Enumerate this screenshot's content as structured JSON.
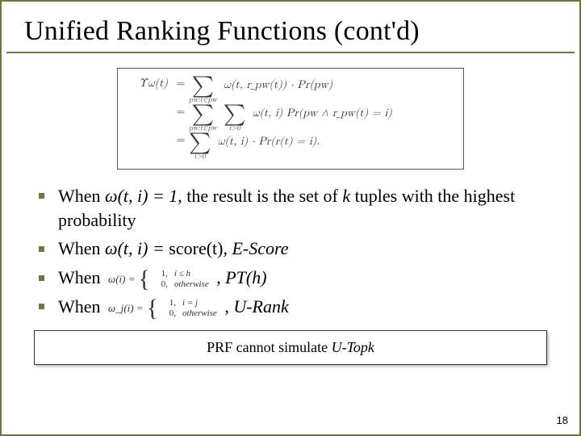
{
  "slide": {
    "title": "Unified Ranking Functions (cont'd)",
    "page_number": "18"
  },
  "equations": {
    "lhs": "Υω(t)",
    "eq": "=",
    "row1_sub": "pw:t∈pw",
    "row1_rhs": "ω(t, r_pw(t)) · Pr(pw)",
    "row2_sub1": "pw:t∈pw",
    "row2_sub2": "i>0",
    "row2_rhs": "ω(t, i) Pr(pw ∧ r_pw(t) = i)",
    "row3_sub": "i>0",
    "row3_rhs": "ω(t, i) · Pr(r(t) = i)."
  },
  "bullets": {
    "b1_pre": "When ",
    "b1_expr": "ω(t, i) = 1",
    "b1_mid": ", the result is the set of ",
    "b1_k": "k",
    "b1_post": " tuples with the highest probability",
    "b2_pre": "When ",
    "b2_expr": "ω(t, i) = ",
    "b2_score": "score(t)",
    "b2_sep": ", ",
    "b2_label": "E-Score",
    "b3_pre": "When ",
    "b3_piece_lhs": "ω(i) =",
    "b3_c1_v": "1,",
    "b3_c1_c": "i ≤ h",
    "b3_c2_v": "0,",
    "b3_c2_c": "otherwise",
    "b3_sep": ", ",
    "b3_label": "PT(h)",
    "b4_pre": "When ",
    "b4_piece_lhs": "ω_j(i) =",
    "b4_c1_v": "1,",
    "b4_c1_c": "i = j",
    "b4_c2_v": "0,",
    "b4_c2_c": "otherwise",
    "b4_sep": ", ",
    "b4_label": "U-Rank"
  },
  "callout": {
    "pre": "PRF cannot simulate ",
    "em": "U-Topk"
  }
}
